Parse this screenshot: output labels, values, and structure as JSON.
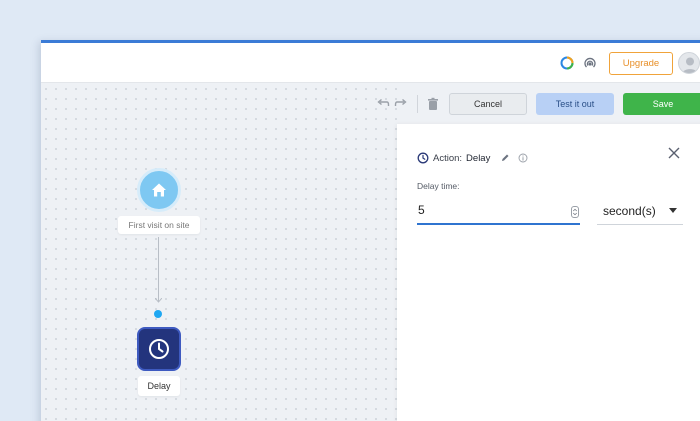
{
  "topbar": {
    "upgrade_label": "Upgrade",
    "icons": [
      "progress-ring-icon",
      "broadcast-icon",
      "avatar"
    ]
  },
  "toolbar": {
    "undo_icon": "undo-icon",
    "redo_icon": "redo-icon",
    "delete_icon": "trash-icon",
    "cancel_label": "Cancel",
    "test_label": "Test it out",
    "save_label": "Save"
  },
  "flow": {
    "trigger": {
      "icon": "home-icon",
      "label": "First visit on site"
    },
    "action": {
      "icon": "clock-icon",
      "label": "Delay"
    }
  },
  "panel": {
    "action_prefix": "Action:",
    "action_name": "Delay",
    "field_label": "Delay time:",
    "delay_value": "5",
    "unit": "second(s)"
  },
  "colors": {
    "accent_blue": "#2f74d0",
    "save_green": "#3fb44a",
    "upgrade_orange": "#f0a33a",
    "test_button": "#b8d0f5",
    "delay_node": "#23347d",
    "trigger_node": "#7ec8f2",
    "connector_dot": "#1ea7f2"
  }
}
